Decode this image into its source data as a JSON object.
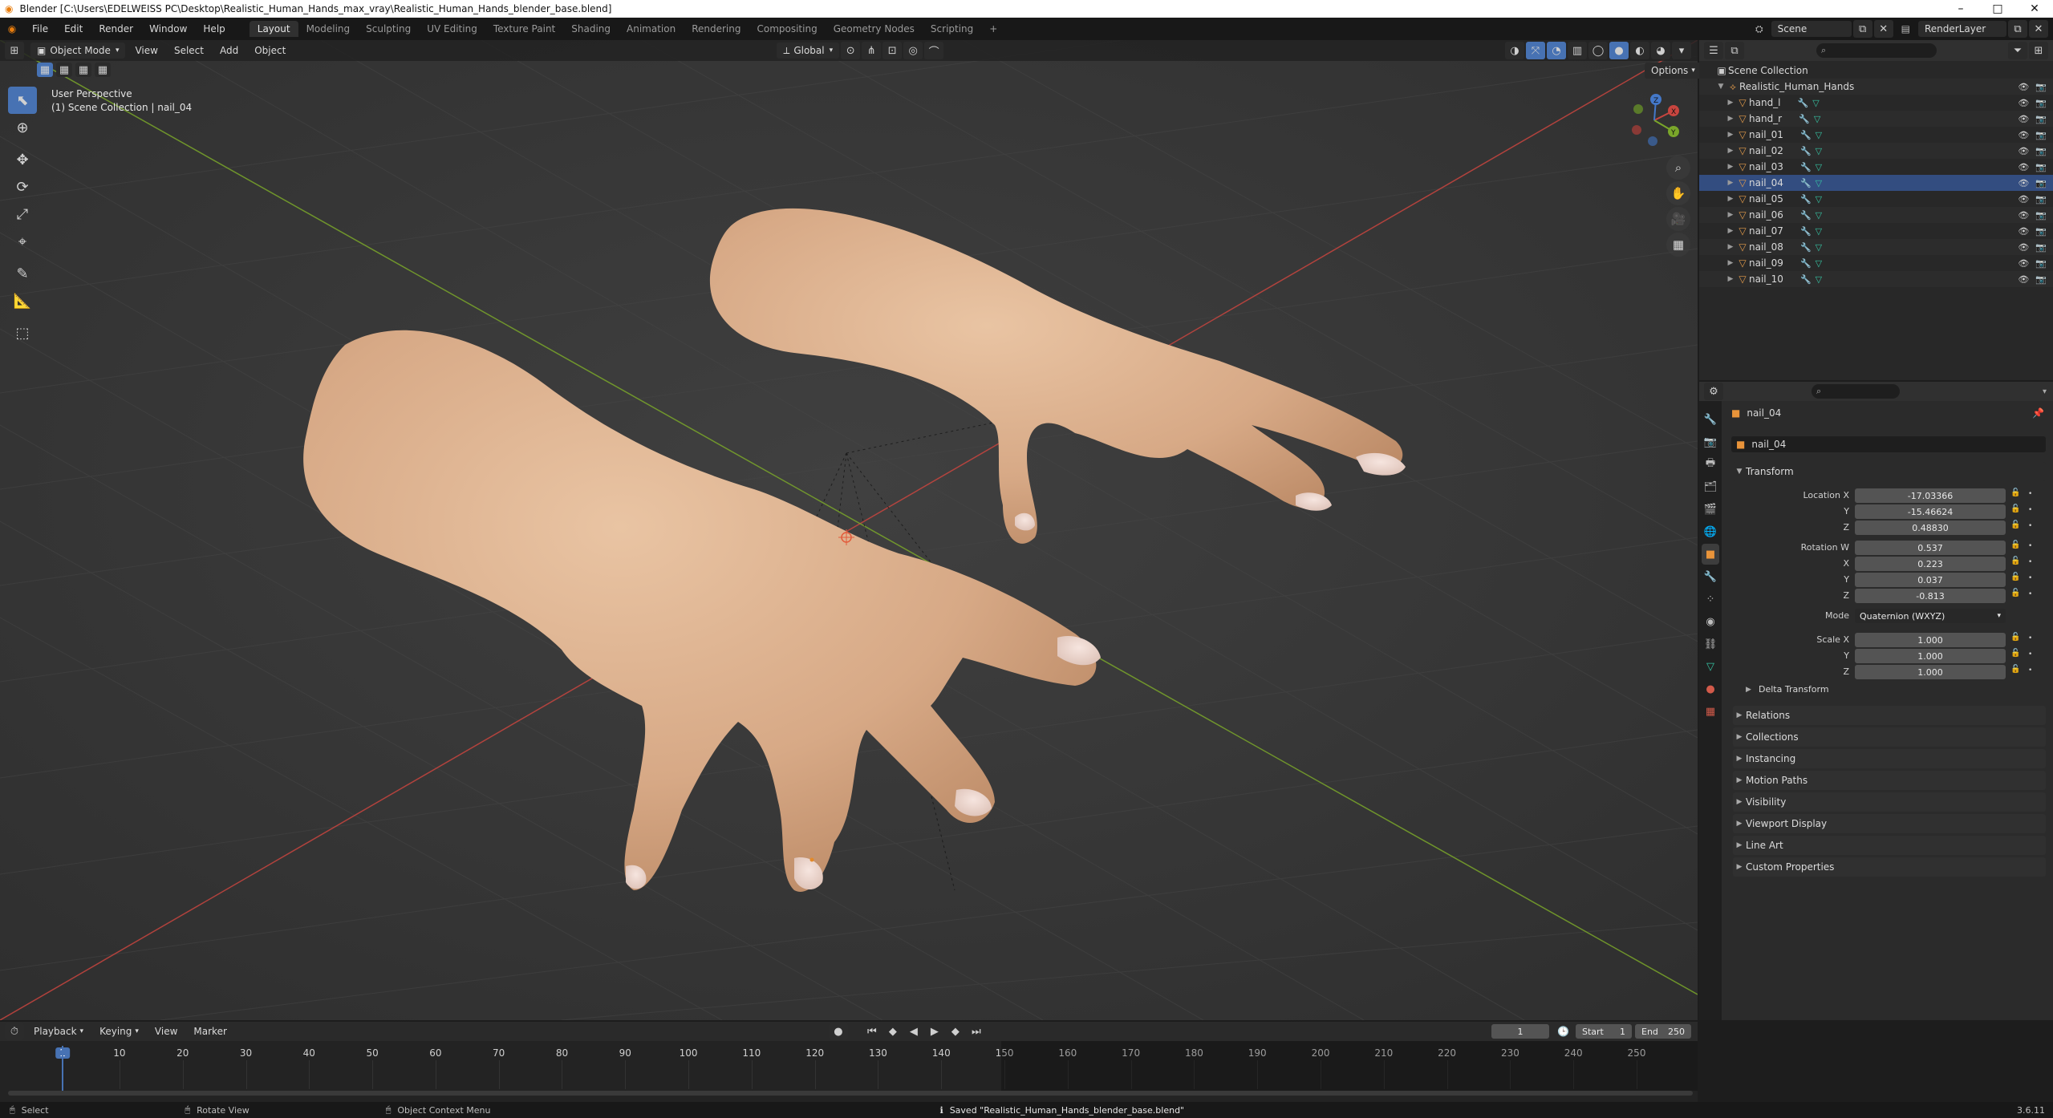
{
  "window": {
    "title": "Blender [C:\\Users\\EDELWEISS PC\\Desktop\\Realistic_Human_Hands_max_vray\\Realistic_Human_Hands_blender_base.blend]",
    "minimize": "–",
    "maximize": "□",
    "close": "✕"
  },
  "menu": [
    "File",
    "Edit",
    "Render",
    "Window",
    "Help"
  ],
  "workspaces": [
    "Layout",
    "Modeling",
    "Sculpting",
    "UV Editing",
    "Texture Paint",
    "Shading",
    "Animation",
    "Rendering",
    "Compositing",
    "Geometry Nodes",
    "Scripting"
  ],
  "active_workspace": "Layout",
  "scene": {
    "label": "Scene",
    "render_layer": "RenderLayer"
  },
  "viewport": {
    "mode": "Object Mode",
    "menus": [
      "View",
      "Select",
      "Add",
      "Object"
    ],
    "orientation": "Global",
    "options": "Options",
    "perspective": "User Perspective",
    "context": "(1) Scene Collection | nail_04",
    "gizmo": {
      "x": "X",
      "y": "Y",
      "z": "Z"
    }
  },
  "outliner": {
    "search_placeholder": "",
    "root": "Scene Collection",
    "collection": "Realistic_Human_Hands",
    "objects": [
      "hand_l",
      "hand_r",
      "nail_01",
      "nail_02",
      "nail_03",
      "nail_04",
      "nail_05",
      "nail_06",
      "nail_07",
      "nail_08",
      "nail_09",
      "nail_10"
    ]
  },
  "properties": {
    "object_name": "nail_04",
    "datablock": "nail_04",
    "transform_title": "Transform",
    "location": {
      "label": "Location X",
      "x": "-17.03366",
      "y": "-15.46624",
      "z": "0.48830"
    },
    "rotation": {
      "label": "Rotation W",
      "w": "0.537",
      "x": "0.223",
      "y": "0.037",
      "z": "-0.813"
    },
    "mode": {
      "label": "Mode",
      "value": "Quaternion (WXYZ)"
    },
    "scale": {
      "label": "Scale X",
      "x": "1.000",
      "y": "1.000",
      "z": "1.000"
    },
    "axis": {
      "x": "X",
      "y": "Y",
      "z": "Z"
    },
    "delta": "Delta Transform",
    "panels": [
      "Relations",
      "Collections",
      "Instancing",
      "Motion Paths",
      "Visibility",
      "Viewport Display",
      "Line Art",
      "Custom Properties"
    ]
  },
  "timeline": {
    "menus": [
      "Playback",
      "Keying",
      "View",
      "Marker"
    ],
    "current_frame": "1",
    "start_label": "Start",
    "start": "1",
    "end_label": "End",
    "end": "250",
    "ticks": [
      "1",
      "10",
      "20",
      "30",
      "40",
      "50",
      "60",
      "70",
      "80",
      "90",
      "100",
      "110",
      "120",
      "130",
      "140",
      "150",
      "160",
      "170",
      "180",
      "190",
      "200",
      "210",
      "220",
      "230",
      "240",
      "250"
    ]
  },
  "status": {
    "select": "Select",
    "rotate": "Rotate View",
    "context_menu": "Object Context Menu",
    "message": "Saved \"Realistic_Human_Hands_blender_base.blend\"",
    "version": "3.6.11"
  },
  "colors": {
    "accent": "#4772b3",
    "selected_row": "#334d80",
    "axis_x": "#c8453f",
    "axis_y": "#7aa62a"
  }
}
